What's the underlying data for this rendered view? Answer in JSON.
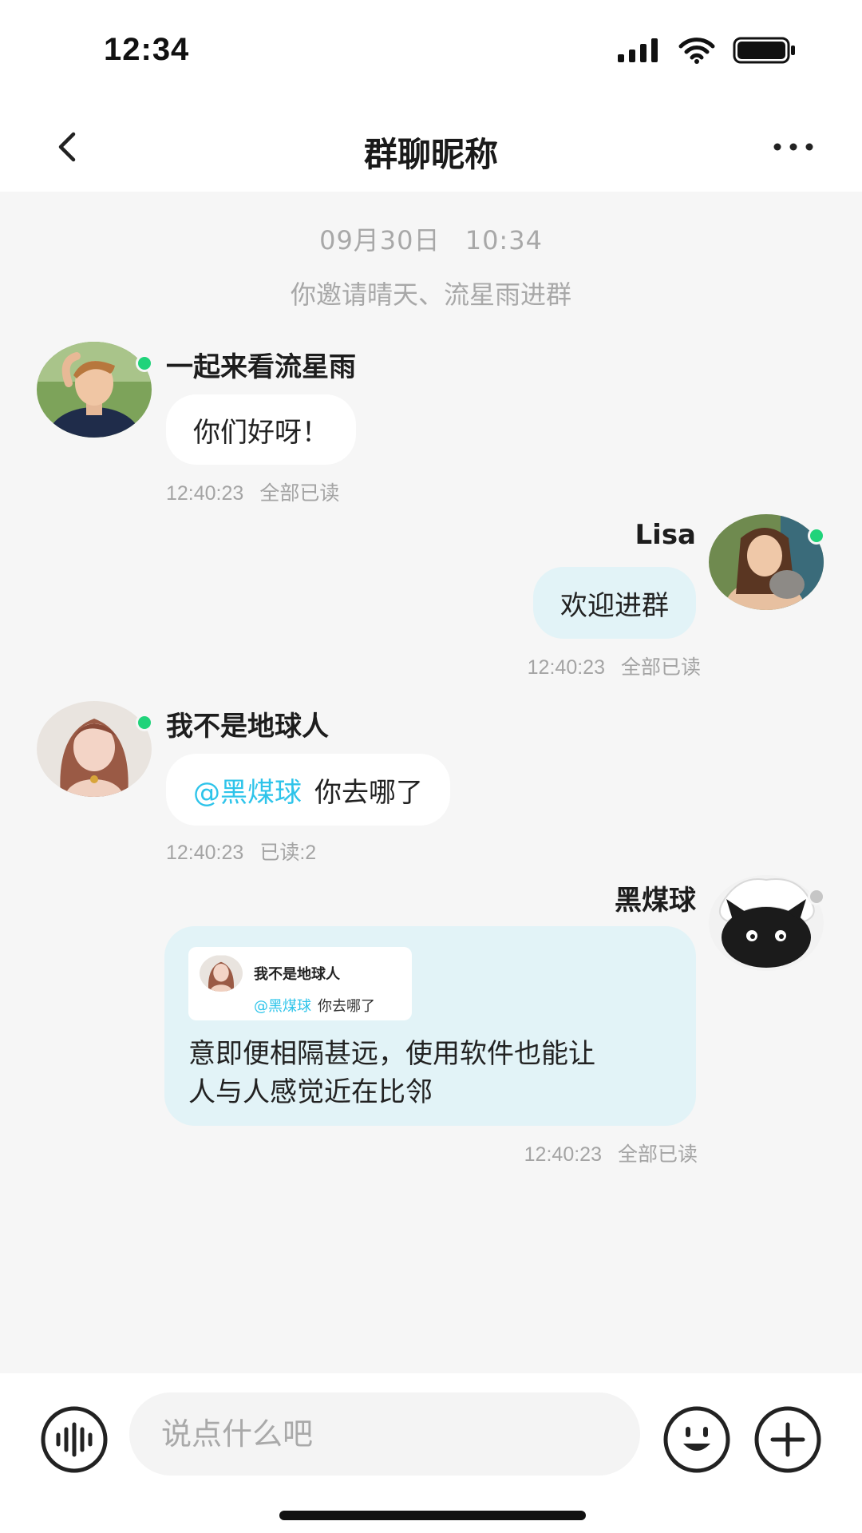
{
  "status": {
    "time": "12:34"
  },
  "nav": {
    "title": "群聊昵称"
  },
  "system": {
    "date": "09月30日",
    "time": "10:34",
    "notice": "你邀请晴天、流星雨进群"
  },
  "messages": [
    {
      "sender": "一起来看流星雨",
      "text": "你们好呀！",
      "time": "12:40:23",
      "read": "全部已读",
      "online": true
    },
    {
      "sender": "Lisa",
      "text": "欢迎进群",
      "time": "12:40:23",
      "read": "全部已读",
      "online": true
    },
    {
      "sender": "我不是地球人",
      "mention": "@黑煤球",
      "text": "你去哪了",
      "time": "12:40:23",
      "read": "已读:2",
      "online": true
    },
    {
      "sender": "黑煤球",
      "quote": {
        "sender": "我不是地球人",
        "mention": "@黑煤球",
        "text": "你去哪了"
      },
      "text_line1": "意即便相隔甚远，使用软件也能让",
      "text_line2": "人与人感觉近在比邻",
      "time": "12:40:23",
      "read": "全部已读",
      "online": false
    }
  ],
  "input": {
    "placeholder": "说点什么吧"
  },
  "colors": {
    "mention": "#2ec4ea",
    "online": "#20d37a",
    "my_bubble": "#e2f3f7",
    "background": "#f6f6f6"
  },
  "icons": [
    "back-icon",
    "more-icon",
    "voice-icon",
    "emoji-icon",
    "plus-icon",
    "signal-icon",
    "wifi-icon",
    "battery-icon"
  ]
}
